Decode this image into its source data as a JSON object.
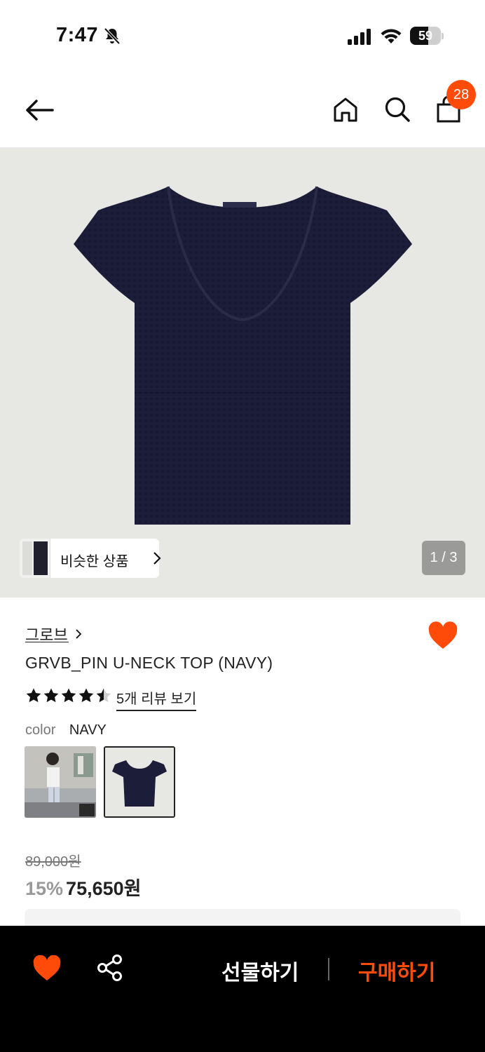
{
  "status_bar": {
    "time": "7:47",
    "battery_level": "59",
    "battery_fraction": 0.59
  },
  "nav": {
    "cart_count": "28"
  },
  "hero": {
    "similar_label": "비슷한 상품",
    "page_indicator": "1 / 3",
    "product_color": "#1c1d38",
    "background_color": "#e7e7e3"
  },
  "product": {
    "brand": "그로브",
    "name": "GRVB_PIN U-NECK TOP (NAVY)",
    "rating": 4.5,
    "review_link": "5개 리뷰 보기",
    "color_label": "color",
    "color_value": "NAVY",
    "original_price": "89,000원",
    "discount": "15%",
    "sale_price": "75,650원",
    "liked": true
  },
  "bottom_bar": {
    "gift_label": "선물하기",
    "buy_label": "구매하기"
  },
  "colors": {
    "accent": "#ff4b0a",
    "text": "#222222",
    "bar_background": "#000000"
  }
}
